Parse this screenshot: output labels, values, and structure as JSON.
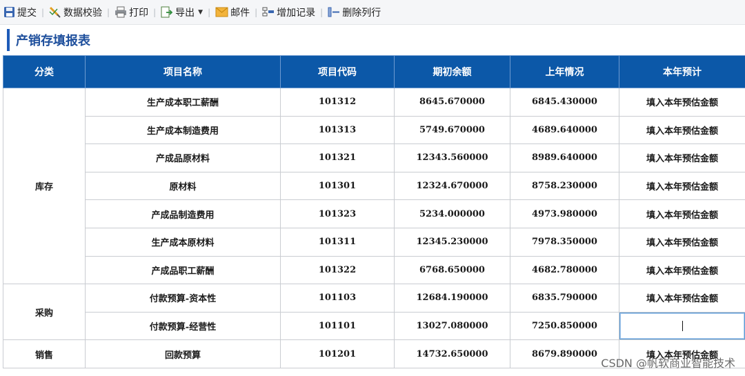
{
  "toolbar": {
    "submit": "提交",
    "validate": "数据校验",
    "print": "打印",
    "export": "导出",
    "mail": "邮件",
    "add_record": "增加记录",
    "delete_row": "删除列行"
  },
  "page_title": "产销存填报表",
  "table": {
    "headers": [
      "分类",
      "项目名称",
      "项目代码",
      "期初余额",
      "上年情况",
      "本年预计"
    ],
    "placeholder": "填入本年预估金额",
    "categories": [
      "库存",
      "采购",
      "销售"
    ],
    "rows": [
      {
        "name": "生产成本职工薪酬",
        "code": "101312",
        "opening": "8645.670000",
        "last_year": "6845.430000"
      },
      {
        "name": "生产成本制造费用",
        "code": "101313",
        "opening": "5749.670000",
        "last_year": "4689.640000"
      },
      {
        "name": "产成品原材料",
        "code": "101321",
        "opening": "12343.560000",
        "last_year": "8989.640000"
      },
      {
        "name": "原材料",
        "code": "101301",
        "opening": "12324.670000",
        "last_year": "8758.230000"
      },
      {
        "name": "产成品制造费用",
        "code": "101323",
        "opening": "5234.000000",
        "last_year": "4973.980000"
      },
      {
        "name": "生产成本原材料",
        "code": "101311",
        "opening": "12345.230000",
        "last_year": "7978.350000"
      },
      {
        "name": "产成品职工薪酬",
        "code": "101322",
        "opening": "6768.650000",
        "last_year": "4682.780000"
      },
      {
        "name": "付款预算-资本性",
        "code": "101103",
        "opening": "12684.190000",
        "last_year": "6835.790000"
      },
      {
        "name": "付款预算-经营性",
        "code": "101101",
        "opening": "13027.080000",
        "last_year": "7250.850000"
      },
      {
        "name": "回款预算",
        "code": "101201",
        "opening": "14732.650000",
        "last_year": "8679.890000"
      }
    ]
  },
  "watermark": "CSDN @帆软商业智能技术",
  "colors": {
    "header_bg": "#0c58a8",
    "title_accent": "#1e5bb8",
    "placeholder": "#c8c8c8"
  }
}
